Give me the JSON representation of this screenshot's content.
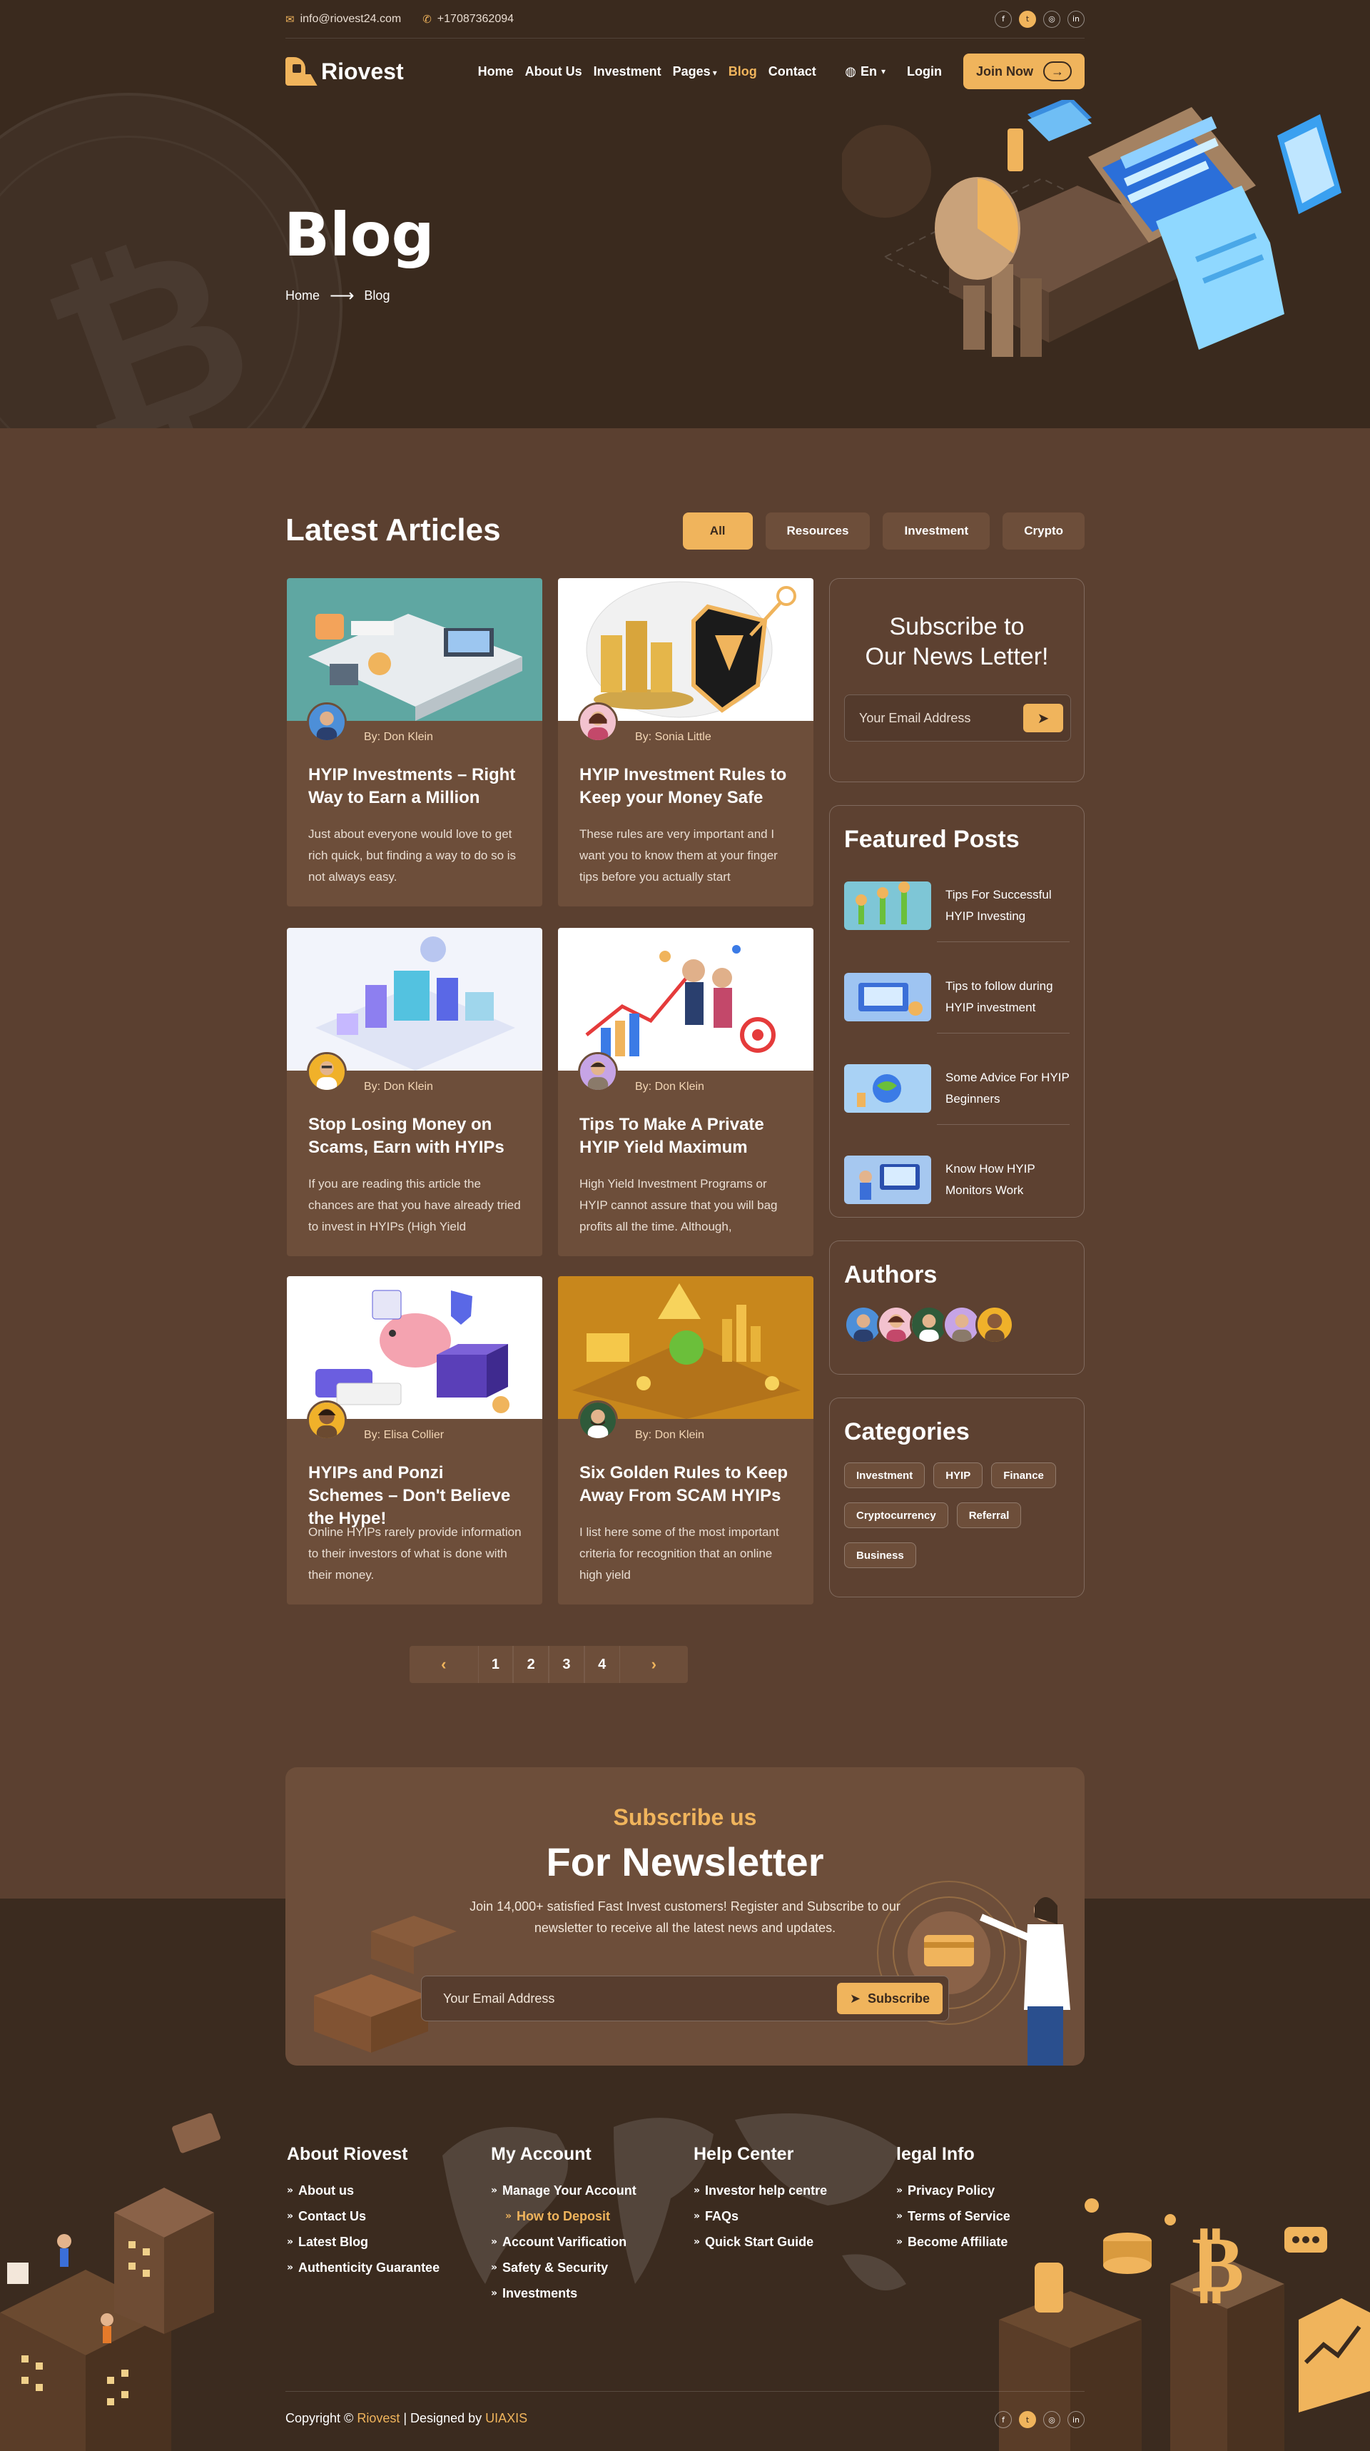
{
  "topbar": {
    "email": "info@riovest24.com",
    "phone": "+17087362094",
    "socials": [
      "facebook-icon",
      "twitter-icon",
      "instagram-icon",
      "linkedin-icon"
    ]
  },
  "nav": {
    "logo": "Riovest",
    "items": [
      "Home",
      "About Us",
      "Investment",
      "Pages",
      "Blog",
      "Contact"
    ],
    "active": "Blog",
    "lang": "En",
    "login": "Login",
    "join": "Join Now"
  },
  "hero": {
    "title": "Blog",
    "breadcrumb": [
      "Home",
      "Blog"
    ]
  },
  "articles": {
    "heading": "Latest Articles",
    "filters": [
      "All",
      "Resources",
      "Investment",
      "Crypto"
    ],
    "active_filter": "All",
    "author_prefix": "By:",
    "items": [
      {
        "author": "Don Klein",
        "title": "HYIP Investments – Right Way to Earn a Million",
        "excerpt": "Just about everyone would love to get rich quick, but finding a way to do so is not always easy."
      },
      {
        "author": "Sonia Little",
        "title": "HYIP Investment Rules to Keep your Money Safe",
        "excerpt": "These rules are very important and I want you to know them at your finger tips before you actually start"
      },
      {
        "author": "Don Klein",
        "title": "Stop Losing Money on Scams, Earn with HYIPs",
        "excerpt": "If you are reading this article the chances are that you have already tried to invest in HYIPs (High Yield"
      },
      {
        "author": "Don Klein",
        "title": "Tips To Make A Private HYIP Yield Maximum",
        "excerpt": "High Yield Investment Programs or HYIP cannot assure that you will bag profits all the time. Although,"
      },
      {
        "author": "Elisa Collier",
        "title": "HYIPs and Ponzi Schemes – Don't Believe the Hype!",
        "excerpt": "Online HYIPs rarely provide information to their investors of what is done with their money."
      },
      {
        "author": "Don Klein",
        "title": "Six Golden Rules to Keep Away From SCAM HYIPs",
        "excerpt": "I list here some of the most important criteria for recognition that an online high yield"
      }
    ]
  },
  "sidebar": {
    "subscribe": {
      "title_line1": "Subscribe to",
      "title_line2": "Our News Letter!",
      "placeholder": "Your Email Address"
    },
    "featured": {
      "heading": "Featured Posts",
      "items": [
        "Tips For Successful HYIP Investing",
        "Tips to follow during HYIP investment",
        "Some Advice For HYIP Beginners",
        "Know How HYIP Monitors Work"
      ]
    },
    "authors": {
      "heading": "Authors"
    },
    "categories": {
      "heading": "Categories",
      "items": [
        "Investment",
        "HYIP",
        "Finance",
        "Cryptocurrency",
        "Referral",
        "Business"
      ]
    }
  },
  "pagination": {
    "prev": "‹",
    "pages": [
      "1",
      "2",
      "3",
      "4"
    ],
    "next": "›"
  },
  "newsletter": {
    "subtitle": "Subscribe us",
    "title": "For Newsletter",
    "description": "Join 14,000+ satisfied Fast Invest customers! Register and Subscribe to our newsletter to receive all the latest news and updates.",
    "placeholder": "Your Email Address",
    "button": "Subscribe"
  },
  "footer": {
    "columns": [
      {
        "heading": "About Riovest",
        "links": [
          "About us",
          "Contact Us",
          "Latest Blog",
          "Authenticity Guarantee"
        ]
      },
      {
        "heading": "My Account",
        "links": [
          "Manage Your Account",
          "How to Deposit",
          "Account Varification",
          "Safety & Security",
          "Investments"
        ]
      },
      {
        "heading": "Help Center",
        "links": [
          "Investor help centre",
          "FAQs",
          "Quick Start Guide"
        ]
      },
      {
        "heading": "legal Info",
        "links": [
          "Privacy Policy",
          "Terms of Service",
          "Become Affiliate"
        ]
      }
    ],
    "copyright_prefix": "Copyright ©",
    "brand": "Riovest",
    "designed_by": "| Designed by",
    "designer": "UIAXIS"
  },
  "colors": {
    "accent": "#f0b45c",
    "dark": "#3a2a1e",
    "page": "#5b4030",
    "card": "#6d4e3a"
  }
}
